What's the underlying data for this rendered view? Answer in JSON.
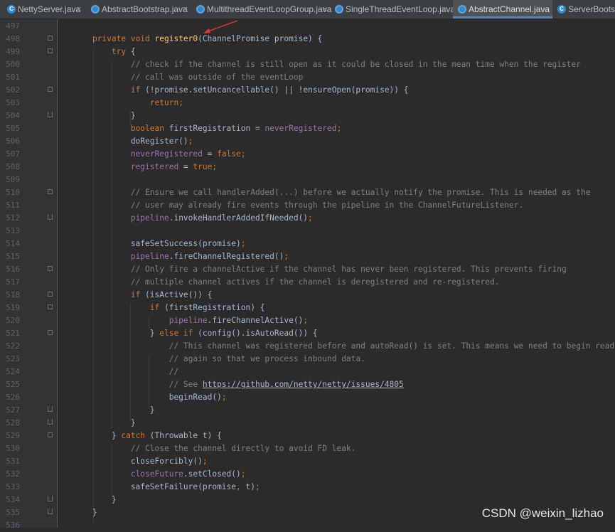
{
  "tabs": [
    {
      "label": "NettyServer.java",
      "icon": "class-icon",
      "active": false
    },
    {
      "label": "AbstractBootstrap.java",
      "icon": "abstract-class-icon",
      "active": false
    },
    {
      "label": "MultithreadEventLoopGroup.java",
      "icon": "abstract-class-icon",
      "active": false
    },
    {
      "label": "SingleThreadEventLoop.java",
      "icon": "abstract-class-icon",
      "active": false
    },
    {
      "label": "AbstractChannel.java",
      "icon": "abstract-class-icon",
      "active": true
    },
    {
      "label": "ServerBootstr",
      "icon": "class-icon",
      "active": false
    }
  ],
  "editor": {
    "lines": [
      {
        "n": "497",
        "t": [
          {
            "x": "",
            "c": ""
          }
        ]
      },
      {
        "n": "498",
        "t": [
          {
            "x": "    ",
            "c": ""
          },
          {
            "x": "private void ",
            "c": "k"
          },
          {
            "x": "register0",
            "c": "m"
          },
          {
            "x": "(ChannelPromise promise) {",
            "c": ""
          }
        ]
      },
      {
        "n": "499",
        "t": [
          {
            "x": "        ",
            "c": ""
          },
          {
            "x": "try",
            "c": "k"
          },
          {
            "x": " {",
            "c": ""
          }
        ]
      },
      {
        "n": "500",
        "t": [
          {
            "x": "            ",
            "c": ""
          },
          {
            "x": "// check if the channel is still open as it could be closed in the mean time when the register",
            "c": "cm"
          }
        ]
      },
      {
        "n": "501",
        "t": [
          {
            "x": "            ",
            "c": ""
          },
          {
            "x": "// call was outside of the eventLoop",
            "c": "cm"
          }
        ]
      },
      {
        "n": "502",
        "t": [
          {
            "x": "            ",
            "c": ""
          },
          {
            "x": "if",
            "c": "k"
          },
          {
            "x": " (!promise.setUncancellable() || !ensureOpen(promise)) {",
            "c": ""
          }
        ]
      },
      {
        "n": "503",
        "t": [
          {
            "x": "                ",
            "c": ""
          },
          {
            "x": "return",
            "c": "k"
          },
          {
            "x": ";",
            "c": "k"
          }
        ]
      },
      {
        "n": "504",
        "t": [
          {
            "x": "            }",
            "c": ""
          }
        ]
      },
      {
        "n": "505",
        "t": [
          {
            "x": "            ",
            "c": ""
          },
          {
            "x": "boolean",
            "c": "k"
          },
          {
            "x": " firstRegistration = ",
            "c": ""
          },
          {
            "x": "neverRegistered",
            "c": "f"
          },
          {
            "x": ";",
            "c": "k"
          }
        ]
      },
      {
        "n": "506",
        "t": [
          {
            "x": "            doRegister()",
            "c": ""
          },
          {
            "x": ";",
            "c": "k"
          }
        ]
      },
      {
        "n": "507",
        "t": [
          {
            "x": "            ",
            "c": ""
          },
          {
            "x": "neverRegistered",
            "c": "f"
          },
          {
            "x": " = ",
            "c": ""
          },
          {
            "x": "false",
            "c": "k"
          },
          {
            "x": ";",
            "c": "k"
          }
        ]
      },
      {
        "n": "508",
        "t": [
          {
            "x": "            ",
            "c": ""
          },
          {
            "x": "registered",
            "c": "f"
          },
          {
            "x": " = ",
            "c": ""
          },
          {
            "x": "true",
            "c": "k"
          },
          {
            "x": ";",
            "c": "k"
          }
        ]
      },
      {
        "n": "509",
        "t": [
          {
            "x": "",
            "c": ""
          }
        ]
      },
      {
        "n": "510",
        "t": [
          {
            "x": "            ",
            "c": ""
          },
          {
            "x": "// Ensure we call handlerAdded(...) before we actually notify the promise. This is needed as the",
            "c": "cm"
          }
        ]
      },
      {
        "n": "511",
        "t": [
          {
            "x": "            ",
            "c": ""
          },
          {
            "x": "// user may already fire events through the pipeline in the ChannelFutureListener.",
            "c": "cm"
          }
        ]
      },
      {
        "n": "512",
        "t": [
          {
            "x": "            ",
            "c": ""
          },
          {
            "x": "pipeline",
            "c": "f"
          },
          {
            "x": ".invokeHandlerAddedIfNeeded()",
            "c": ""
          },
          {
            "x": ";",
            "c": "k"
          }
        ]
      },
      {
        "n": "513",
        "t": [
          {
            "x": "",
            "c": ""
          }
        ]
      },
      {
        "n": "514",
        "t": [
          {
            "x": "            safeSetSuccess(promise)",
            "c": ""
          },
          {
            "x": ";",
            "c": "k"
          }
        ]
      },
      {
        "n": "515",
        "t": [
          {
            "x": "            ",
            "c": ""
          },
          {
            "x": "pipeline",
            "c": "f"
          },
          {
            "x": ".fireChannelRegistered()",
            "c": ""
          },
          {
            "x": ";",
            "c": "k"
          }
        ]
      },
      {
        "n": "516",
        "t": [
          {
            "x": "            ",
            "c": ""
          },
          {
            "x": "// Only fire a channelActive if the channel has never been registered. This prevents firing",
            "c": "cm"
          }
        ]
      },
      {
        "n": "517",
        "t": [
          {
            "x": "            ",
            "c": ""
          },
          {
            "x": "// multiple channel actives if the channel is deregistered and re-registered.",
            "c": "cm"
          }
        ]
      },
      {
        "n": "518",
        "t": [
          {
            "x": "            ",
            "c": ""
          },
          {
            "x": "if",
            "c": "k"
          },
          {
            "x": " (isActive()) {",
            "c": ""
          }
        ]
      },
      {
        "n": "519",
        "t": [
          {
            "x": "                ",
            "c": ""
          },
          {
            "x": "if",
            "c": "k"
          },
          {
            "x": " (firstRegistration) {",
            "c": ""
          }
        ]
      },
      {
        "n": "520",
        "t": [
          {
            "x": "                    ",
            "c": ""
          },
          {
            "x": "pipeline",
            "c": "f"
          },
          {
            "x": ".fireChannelActive()",
            "c": ""
          },
          {
            "x": ";",
            "c": "k"
          }
        ]
      },
      {
        "n": "521",
        "t": [
          {
            "x": "                } ",
            "c": ""
          },
          {
            "x": "else if",
            "c": "k"
          },
          {
            "x": " (config().isAutoRead()) {",
            "c": ""
          }
        ]
      },
      {
        "n": "522",
        "t": [
          {
            "x": "                    ",
            "c": ""
          },
          {
            "x": "// This channel was registered before and autoRead() is set. This means we need to begin read",
            "c": "cm"
          }
        ]
      },
      {
        "n": "523",
        "t": [
          {
            "x": "                    ",
            "c": ""
          },
          {
            "x": "// again so that we process inbound data.",
            "c": "cm"
          }
        ]
      },
      {
        "n": "524",
        "t": [
          {
            "x": "                    ",
            "c": ""
          },
          {
            "x": "//",
            "c": "cm"
          }
        ]
      },
      {
        "n": "525",
        "t": [
          {
            "x": "                    ",
            "c": ""
          },
          {
            "x": "// See ",
            "c": "cm"
          },
          {
            "x": "https://github.com/netty/netty/issues/4805",
            "c": "lnk"
          }
        ]
      },
      {
        "n": "526",
        "t": [
          {
            "x": "                    beginRead()",
            "c": ""
          },
          {
            "x": ";",
            "c": "k"
          }
        ]
      },
      {
        "n": "527",
        "t": [
          {
            "x": "                }",
            "c": ""
          }
        ]
      },
      {
        "n": "528",
        "t": [
          {
            "x": "            }",
            "c": ""
          }
        ]
      },
      {
        "n": "529",
        "t": [
          {
            "x": "        } ",
            "c": ""
          },
          {
            "x": "catch",
            "c": "k"
          },
          {
            "x": " (Throwable t) {",
            "c": ""
          }
        ]
      },
      {
        "n": "530",
        "t": [
          {
            "x": "            ",
            "c": ""
          },
          {
            "x": "// Close the channel directly to avoid FD leak.",
            "c": "cm"
          }
        ]
      },
      {
        "n": "531",
        "t": [
          {
            "x": "            closeForcibly()",
            "c": ""
          },
          {
            "x": ";",
            "c": "k"
          }
        ]
      },
      {
        "n": "532",
        "t": [
          {
            "x": "            ",
            "c": ""
          },
          {
            "x": "closeFuture",
            "c": "f"
          },
          {
            "x": ".setClosed()",
            "c": ""
          },
          {
            "x": ";",
            "c": "k"
          }
        ]
      },
      {
        "n": "533",
        "t": [
          {
            "x": "            safeSetFailure(promise",
            "c": ""
          },
          {
            "x": ", ",
            "c": "k"
          },
          {
            "x": "t)",
            "c": ""
          },
          {
            "x": ";",
            "c": "k"
          }
        ]
      },
      {
        "n": "534",
        "t": [
          {
            "x": "        }",
            "c": ""
          }
        ]
      },
      {
        "n": "535",
        "t": [
          {
            "x": "    }",
            "c": ""
          }
        ]
      },
      {
        "n": "536",
        "t": [
          {
            "x": "",
            "c": ""
          }
        ]
      }
    ]
  },
  "watermark": "CSDN @weixin_lizhao",
  "colors": {
    "keyword": "#cc7832",
    "comment": "#808080",
    "field": "#9876aa",
    "method": "#ffc66d",
    "text": "#a9b7c6",
    "arrow": "#e53935"
  }
}
